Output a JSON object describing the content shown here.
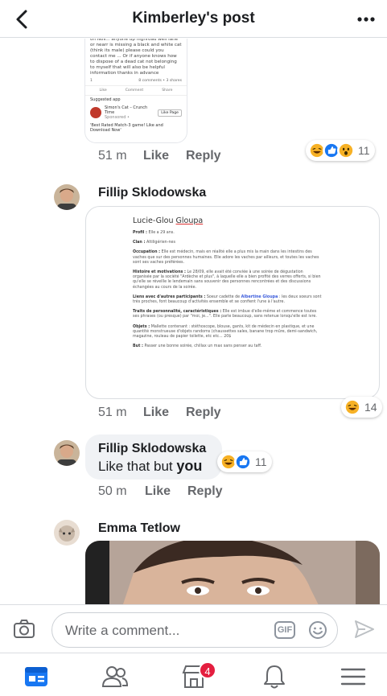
{
  "header": {
    "title": "Kimberley's post"
  },
  "shared_post": {
    "text": "an old lurcher who was looking for home on Nov... anyone up highroad well lane or nearr is missing a black and white cat (think its male) please could you contact me ... Or if anyone knows how to dispose of a dead cat not belonging to myself that will also be helpful information thanks in advance",
    "reaction_count": "1",
    "comments_shares": "8 comments • 3 shares",
    "actions": [
      "Like",
      "Comment",
      "Share"
    ],
    "suggested_label": "Suggested app",
    "game_name": "Simon's Cat – Crunch Time",
    "game_sub": "Sponsored •",
    "game_button": "Like Page",
    "game_desc": "'Best Rated Match-3 game! Like and Download Now'"
  },
  "comments": [
    {
      "time": "51 m",
      "like": "Like",
      "reply": "Reply",
      "reaction_count": "11"
    },
    {
      "author": "Fillip Sklodowska",
      "time": "51 m",
      "like": "Like",
      "reply": "Reply",
      "reaction_count": "14",
      "document": {
        "title_a": "Lucie-Glou",
        "title_b": "Gloupa",
        "profil_label": "Profil :",
        "profil": "Elle a 29 ans.",
        "clan_label": "Clan :",
        "clan": "Altiligérien-nes",
        "occ_label": "Occupation :",
        "occ": "Elle est médecin, mais en réalité elle a plus mis la main dans les intestins des vaches que sur des personnes humaines. Elle adore les vaches par ailleurs, et toutes les vaches sont ses vaches préférées.",
        "hist_label": "Histoire et motivations :",
        "hist": "Le 28/09, elle avait été conviée à une soirée de dégustation organisée par la société \"Ardèche et plus\", à laquelle elle a bien profité des verres offerts, si bien qu'elle se réveille le lendemain sans souvenir des personnes rencontrées et des discussions échangées au cours de la soirée.",
        "liens_label": "Liens avec d'autres participants :",
        "liens_a": "Soeur cadette de",
        "liens_name": "Albertine Gloupa",
        "liens_b": ": les deux soeurs sont très proches, font beaucoup d'activités ensemble et se confient l'une à l'autre.",
        "traits_label": "Traits de personnalité, caractéristiques :",
        "traits": "Elle est imbue d'elle-même et commence toutes ses phrases (ou presque) par \"moi, je...\". Elle parle beaucoup, sans retenue lorsqu'elle est ivre.",
        "obj_label": "Objets :",
        "obj": "Mallette contenant : stéthoscope, blouse, gants, kit de médecin en plastique, et une quantité monstrueuse d'objets randoms (chaussettes sales, banane trop mûre, demi-sandwich, magazine, rouleau de papier toilette, etc etc... 20$",
        "but_label": "But :",
        "but": "Passer une bonne soirée, chillax un max sans penser au taff."
      }
    },
    {
      "author": "Fillip Sklodowska",
      "text_a": "Like that but ",
      "text_b": "you",
      "time": "50 m",
      "like": "Like",
      "reply": "Reply",
      "reaction_count": "11"
    },
    {
      "author": "Emma Tetlow"
    }
  ],
  "composer": {
    "placeholder": "Write a comment...",
    "gif_label": "GIF"
  },
  "nav": {
    "badge": "4"
  },
  "colors": {
    "brand": "#1877f2",
    "badge": "#e41e3f",
    "meta": "#65676b"
  }
}
